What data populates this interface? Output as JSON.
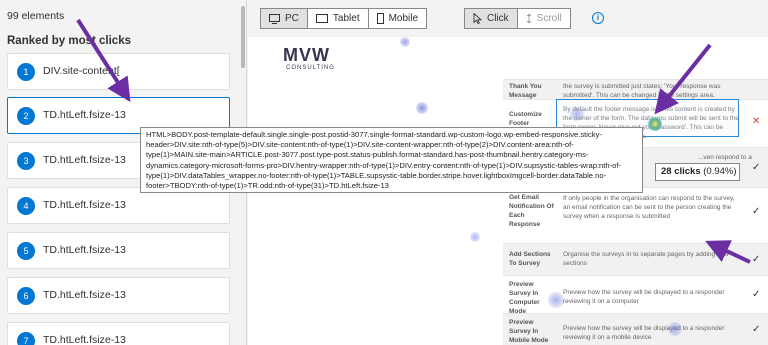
{
  "panel": {
    "element_count": "99 elements",
    "ranking_title": "Ranked by most clicks",
    "items": [
      {
        "rank": "1",
        "label": "DIV.site-content["
      },
      {
        "rank": "2",
        "label": "TD.htLeft.fsize-13"
      },
      {
        "rank": "3",
        "label": "TD.htLeft.fsize-13"
      },
      {
        "rank": "4",
        "label": "TD.htLeft.fsize-13"
      },
      {
        "rank": "5",
        "label": "TD.htLeft.fsize-13"
      },
      {
        "rank": "6",
        "label": "TD.htLeft.fsize-13"
      },
      {
        "rank": "7",
        "label": "TD.htLeft.fsize-13"
      }
    ]
  },
  "toolbar": {
    "devices": [
      "PC",
      "Tablet",
      "Mobile"
    ],
    "active_device": "PC",
    "modes": [
      "Click",
      "Scroll"
    ],
    "active_mode": "Click",
    "info_icon": "info-icon"
  },
  "preview": {
    "logo_main": "MVW",
    "logo_sub": "CONSULTING",
    "rows": [
      {
        "label": "Thank You Message",
        "desc": "the survey is submitted just states: 'Your response was submitted'. This can be changed in the settings area.",
        "mark": ""
      },
      {
        "label": "Customize Footer",
        "desc": "By default the footer message is: 'This content is created by the owner of the form. The data you submit will be sent to the form owner. Never give out your password'. This can be changed in the settings area.",
        "mark": "✕"
      },
      {
        "label": "",
        "desc": "...ven respond to a survey",
        "mark": "✓"
      },
      {
        "label": "Get Email Notification Of Each Response",
        "desc": "If only people in the organisation can respond to the survey, an email notification can be sent to the person creating the survey when a response is submitted",
        "mark": "✓"
      },
      {
        "label": "Add Sections To Survey",
        "desc": "Organise the surveys in to separate pages by adding new sections",
        "mark": "✓"
      },
      {
        "label": "Preview Survey In Computer Mode",
        "desc": "Preview how the survey will be displayed to a responder reviewing it on a computer",
        "mark": "✓"
      },
      {
        "label": "Preview Survey In Mobile Mode",
        "desc": "Preview how the survey will be displayed to a responder reviewing it on a mobile device",
        "mark": "✓"
      }
    ]
  },
  "selector_tooltip": "HTML>BODY.post-template-default.single.single-post.postid-3077.single-format-standard.wp-custom-logo.wp-embed-responsive.sticky-header>DIV.site:nth-of-type(5)>DIV.site-content:nth-of-type(1)>DIV.site-content-wrapper:nth-of-type(2)>DIV.content-area:nth-of-type(1)>MAIN.site-main>ARTICLE.post-3077.post.type-post.status-publish.format-standard.has-post-thumbnail.hentry.category-ms-dynamics.category-microsoft-forms-pro>DIV.hentry-wrapper:nth-of-type(1)>DIV.entry-content:nth-of-type(1)>DIV.supsystic-tables-wrap:nth-of-type(1)>DIV.dataTables_wrapper.no-footer:nth-of-type(1)>TABLE.supsystic-table.border.stripe.hover.lightboxImgcell-border.dataTable.no-footer>TBODY:nth-of-type(1)>TR.odd:nth-of-type(31)>TD.htLeft.fsize-13",
  "click_tooltip": {
    "count": "28 clicks",
    "pct": "(0.94%)"
  },
  "colors": {
    "accent": "#0078d4",
    "arrow": "#6b2fa3"
  }
}
